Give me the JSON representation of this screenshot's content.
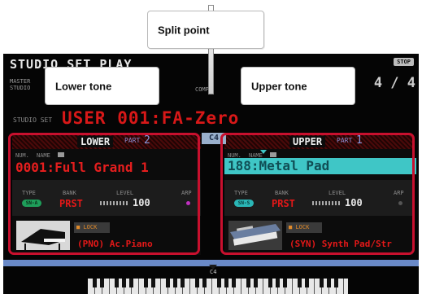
{
  "callouts": {
    "split_point": "Split point",
    "lower_tone": "Lower tone",
    "upper_tone": "Upper tone"
  },
  "header": {
    "title": "STUDIO SET PLAY",
    "left_small_1": "MASTER",
    "left_small_2": "STUDIO",
    "comp": "COMP",
    "stop": "STOP",
    "page": "4 / 4"
  },
  "studio_set": {
    "label": "STUDIO SET",
    "name": "USER 001:FA-Zero"
  },
  "split_key": "C4",
  "lower": {
    "name": "LOWER",
    "part_label": "PART",
    "part_num": "2",
    "num_label": "NUM.",
    "name_label": "NAME",
    "tone": "0001:Full Grand 1",
    "type_label": "TYPE",
    "bank_label": "BANK",
    "level_label": "LEVEL",
    "arp_label": "ARP",
    "type": "SN-A",
    "bank": "PRST",
    "level": "100",
    "lock": "LOCK",
    "category": "(PNO) Ac.Piano"
  },
  "upper": {
    "name": "UPPER",
    "part_label": "PART",
    "part_num": "1",
    "num_label": "NUM.",
    "name_label": "NAME",
    "tone": "188:Metal Pad",
    "type_label": "TYPE",
    "bank_label": "BANK",
    "level_label": "LEVEL",
    "arp_label": "ARP",
    "type": "SN-S",
    "bank": "PRST",
    "level": "100",
    "lock": "LOCK",
    "category": "(SYN) Synth Pad/Str"
  },
  "keyboard_label": "C4",
  "colors": {
    "frame": "#c8102e",
    "tone_red": "#e51e1e",
    "highlight_cyan": "#3fc6c6"
  }
}
